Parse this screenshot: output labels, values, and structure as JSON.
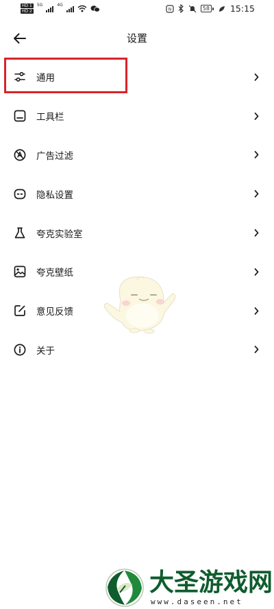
{
  "status_bar": {
    "sim1": "HD 1",
    "sim2": "HD 2",
    "net1": "5G",
    "net2": "4G",
    "battery": "58",
    "time": "15:15",
    "icons": [
      "nfc-icon",
      "bluetooth-icon",
      "mute-icon",
      "vibrate-icon"
    ]
  },
  "header": {
    "back_icon": "arrow-left-icon",
    "title": "设置"
  },
  "menu": {
    "items": [
      {
        "label": "通用",
        "icon": "sliders-icon",
        "highlighted": true
      },
      {
        "label": "工具栏",
        "icon": "toolbar-icon"
      },
      {
        "label": "广告过滤",
        "icon": "ad-filter-icon"
      },
      {
        "label": "隐私设置",
        "icon": "privacy-icon"
      },
      {
        "label": "夸克实验室",
        "icon": "flask-icon"
      },
      {
        "label": "夸克壁纸",
        "icon": "image-icon"
      },
      {
        "label": "意见反馈",
        "icon": "edit-icon"
      },
      {
        "label": "关于",
        "icon": "info-icon"
      }
    ],
    "chevron_icon": "chevron-right-icon"
  },
  "colors": {
    "highlight_border": "#d8232a",
    "watermark_green": "#0f5c2e"
  },
  "watermark": {
    "title": "大圣游戏网",
    "url": "www.daseen.net"
  }
}
